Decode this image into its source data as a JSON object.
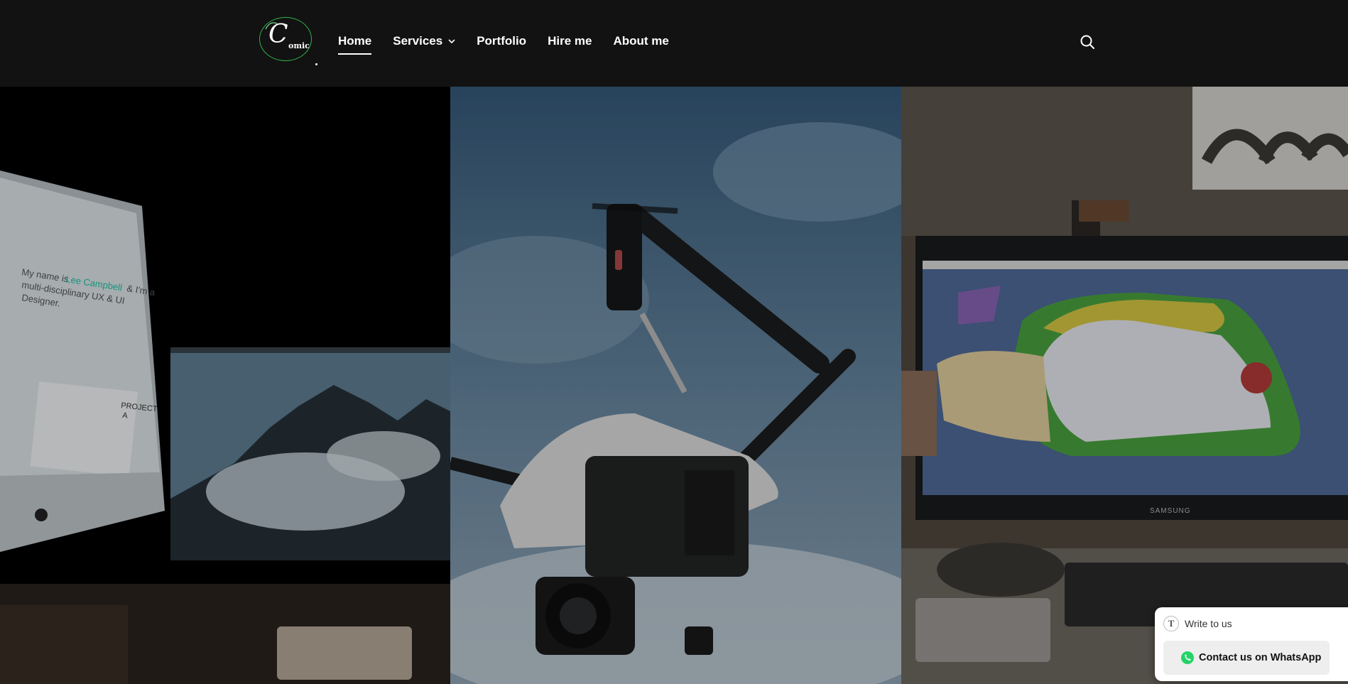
{
  "header": {
    "logo": {
      "letter": "C",
      "text": "omic"
    },
    "nav": [
      {
        "label": "Home",
        "active": true
      },
      {
        "label": "Services",
        "has_dropdown": true
      },
      {
        "label": "Portfolio"
      },
      {
        "label": "Hire me"
      },
      {
        "label": "About me"
      }
    ],
    "search_icon": "search-icon"
  },
  "hero": {
    "panels": [
      {
        "name": "desk-monitor-photo",
        "screen_text": "My name is Lee Campbell & I'm a multi-disciplinary UX & UI Designer.",
        "highlight": "Lee Campbell",
        "project_label": "PROJECT A"
      },
      {
        "name": "drone-photo"
      },
      {
        "name": "cad-workstation-photo",
        "monitor_brand": "SAMSUNG"
      }
    ]
  },
  "widget": {
    "write_label": "Write to us",
    "whatsapp_label": "Contact us on WhatsApp",
    "colors": {
      "whatsapp": "#25d366"
    }
  },
  "colors": {
    "header_bg": "#121212",
    "logo_ring": "#2fb24a",
    "accent_text": "#1fc7a6"
  }
}
